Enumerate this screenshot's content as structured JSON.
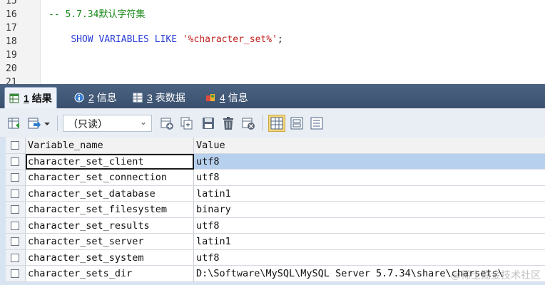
{
  "editor": {
    "lines": [
      {
        "num": "15",
        "text": ""
      },
      {
        "num": "16",
        "text": "-- 5.7.34默认字符集"
      },
      {
        "num": "17",
        "text": ""
      },
      {
        "num": "18",
        "text": ""
      },
      {
        "num": "19",
        "text": ""
      },
      {
        "num": "20",
        "text": ""
      },
      {
        "num": "21",
        "text": ""
      }
    ],
    "line17": {
      "keywords": "SHOW VARIABLES LIKE",
      "string": "'%character_set%'",
      "end": ";"
    }
  },
  "tabs": [
    {
      "num": "1",
      "label": "结果",
      "icon": "result-table-icon"
    },
    {
      "num": "2",
      "label": "信息",
      "icon": "info-icon"
    },
    {
      "num": "3",
      "label": "表数据",
      "icon": "table-data-icon"
    },
    {
      "num": "4",
      "label": "信息",
      "icon": "info-badge-icon"
    }
  ],
  "toolbar": {
    "mode_dropdown": "（只读）",
    "icons": [
      "export-icon",
      "import-icon",
      "add-row-icon",
      "duplicate-row-icon",
      "save-icon",
      "delete-icon",
      "cancel-icon",
      "grid-view-icon",
      "form-view-icon",
      "text-view-icon"
    ]
  },
  "grid": {
    "columns": [
      "Variable_name",
      "Value"
    ],
    "rows": [
      [
        "character_set_client",
        "utf8"
      ],
      [
        "character_set_connection",
        "utf8"
      ],
      [
        "character_set_database",
        "latin1"
      ],
      [
        "character_set_filesystem",
        "binary"
      ],
      [
        "character_set_results",
        "utf8"
      ],
      [
        "character_set_server",
        "latin1"
      ],
      [
        "character_set_system",
        "utf8"
      ],
      [
        "character_sets_dir",
        "D:\\Software\\MySQL\\MySQL Server 5.7.34\\share\\charsets\\"
      ]
    ]
  },
  "watermark": "@稀土掘金技术社区",
  "colors": {
    "comment": "#1a8a1a",
    "keyword": "#2a3fd6",
    "string": "#c11e1e",
    "tabbar": "#394f6d",
    "selected_cell": "#b7d0ee"
  }
}
